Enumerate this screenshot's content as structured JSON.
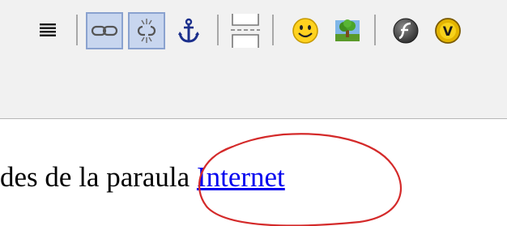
{
  "toolbar": {
    "buttons": [
      {
        "name": "justify-full-button",
        "icon": "justify-icon",
        "active": false
      },
      {
        "name": "insert-link-button",
        "icon": "link-icon",
        "active": true
      },
      {
        "name": "remove-link-button",
        "icon": "unlink-icon",
        "active": true
      },
      {
        "name": "anchor-button",
        "icon": "anchor-icon",
        "active": false
      },
      {
        "name": "page-break-button",
        "icon": "page-break-icon",
        "active": false
      },
      {
        "name": "smiley-button",
        "icon": "smiley-icon",
        "active": false
      },
      {
        "name": "insert-image-button",
        "icon": "image-icon",
        "active": false
      },
      {
        "name": "insert-flash-button",
        "icon": "flash-icon",
        "active": false
      },
      {
        "name": "insert-video-button",
        "icon": "video-icon",
        "active": false
      }
    ],
    "video_icon_letter": "V"
  },
  "editor": {
    "text_before_link": "des de la paraula ",
    "link_text": "Internet"
  },
  "colors": {
    "toolbar_bg": "#f1f1f1",
    "active_button_bg": "#c8d6ef",
    "active_button_border": "#8aa2cf",
    "link": "#0000ee",
    "annotation_circle": "#d42a2a"
  }
}
